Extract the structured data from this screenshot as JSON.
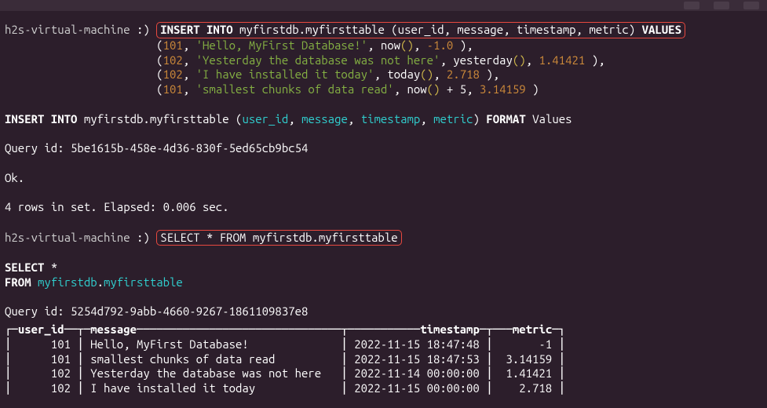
{
  "window": {
    "title_bar": ""
  },
  "prompt": {
    "host": "h2s-virtual-machine",
    "smiley": ":)"
  },
  "insert_cmd": {
    "insert_into": "INSERT INTO",
    "db_table": "myfirstdb.myfirsttable",
    "open_paren": "(",
    "col_user_id": "user_id",
    "col_message": "message",
    "col_timestamp": "timestamp",
    "col_metric": "metric",
    "close_paren": ")",
    "values_kw": "VALUES",
    "row1": {
      "id": "101",
      "msg": "'Hello, MyFirst Database!'",
      "fn": "now",
      "metric": "-1.0"
    },
    "row2": {
      "id": "102",
      "msg": "'Yesterday the database was not here'",
      "fn": "yesterday",
      "metric": "1.41421"
    },
    "row3": {
      "id": "102",
      "msg": "'I have installed it today'",
      "fn": "today",
      "metric": "2.718"
    },
    "row4": {
      "id": "101",
      "msg": "'smallest chunks of data read'",
      "fn": "now",
      "plus5": "+ 5",
      "metric": "3.14159"
    }
  },
  "echo_insert": {
    "insert_into": "INSERT INTO",
    "db_table": "myfirstdb.myfirsttable",
    "open_paren": "(",
    "col_user_id": "user_id",
    "col_message": "message",
    "col_timestamp": "timestamp",
    "col_metric": "metric",
    "close_paren": ")",
    "format_kw": "FORMAT",
    "values_kw": "Values"
  },
  "query1": {
    "label": "Query id:",
    "id": "5be1615b-458e-4d36-830f-5ed65cb9bc54",
    "ok": "Ok.",
    "rows": "4 rows in set. Elapsed: 0.006 sec."
  },
  "select_cmd": {
    "text": "SELECT * FROM myfirstdb.myfirsttable"
  },
  "echo_select": {
    "select": "SELECT",
    "star": "*",
    "from": "FROM",
    "db": "myfirstdb",
    "dot": ".",
    "table": "myfirsttable"
  },
  "query2": {
    "label": "Query id:",
    "id": "5254d792-9abb-4660-9267-1861109837e8"
  },
  "table": {
    "header": {
      "user_id": "user_id",
      "message": "message",
      "timestamp": "timestamp",
      "metric": "metric"
    },
    "rows": [
      {
        "user_id": "101",
        "message": "Hello, MyFirst Database!",
        "timestamp": "2022-11-15 18:47:48",
        "metric": "-1"
      },
      {
        "user_id": "101",
        "message": "smallest chunks of data read",
        "timestamp": "2022-11-15 18:47:53",
        "metric": "3.14159"
      },
      {
        "user_id": "102",
        "message": "Yesterday the database was not here",
        "timestamp": "2022-11-14 00:00:00",
        "metric": "1.41421"
      },
      {
        "user_id": "102",
        "message": "I have installed it today",
        "timestamp": "2022-11-15 00:00:00",
        "metric": "2.718"
      }
    ]
  },
  "chart_data": {
    "type": "table",
    "columns": [
      "user_id",
      "message",
      "timestamp",
      "metric"
    ],
    "rows": [
      [
        101,
        "Hello, MyFirst Database!",
        "2022-11-15 18:47:48",
        -1
      ],
      [
        101,
        "smallest chunks of data read",
        "2022-11-15 18:47:53",
        3.14159
      ],
      [
        102,
        "Yesterday the database was not here",
        "2022-11-14 00:00:00",
        1.41421
      ],
      [
        102,
        "I have installed it today",
        "2022-11-15 00:00:00",
        2.718
      ]
    ]
  },
  "punct": {
    "comma": ",",
    "comma_sp": ", ",
    "open": "(",
    "close": ")",
    "close_comma": "),",
    "parens": "()",
    "space": " "
  }
}
